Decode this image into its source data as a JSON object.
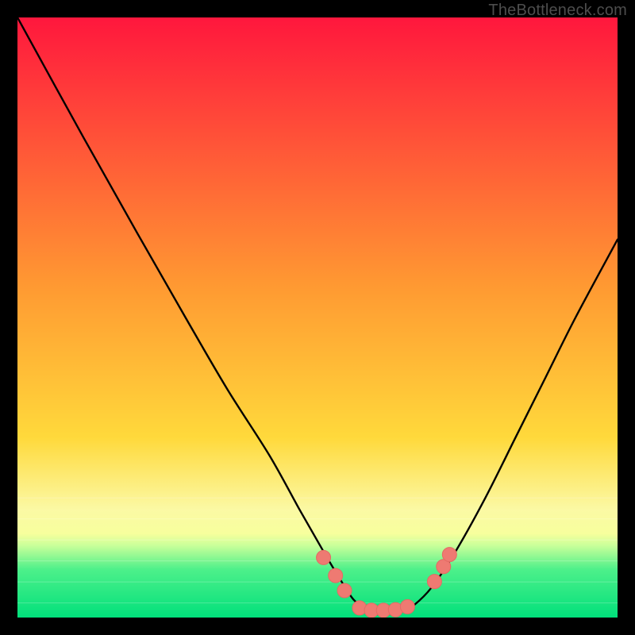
{
  "attribution": "TheBottleneck.com",
  "colors": {
    "grad_top": "#ff173d",
    "grad_mid": "#ffd93b",
    "grad_band_light": "#fbf9a4",
    "grad_band_green_top": "#4df08a",
    "grad_band_green_bot": "#01e07b",
    "curve": "#000000",
    "marker_fill": "#ee7a72",
    "marker_stroke": "#e46a63"
  },
  "chart_data": {
    "type": "line",
    "title": "",
    "xlabel": "",
    "ylabel": "",
    "xlim": [
      0,
      100
    ],
    "ylim": [
      0,
      100
    ],
    "series": [
      {
        "name": "bottleneck-curve",
        "x": [
          0,
          11,
          20,
          28,
          35,
          42,
          47,
          51,
          54,
          56,
          58,
          60,
          62,
          64,
          66,
          69,
          73,
          78,
          83,
          88,
          93,
          100
        ],
        "y": [
          100,
          80,
          64,
          50,
          38,
          27,
          18,
          11,
          6,
          3,
          1.5,
          1,
          1,
          1,
          2,
          5,
          11,
          20,
          30,
          40,
          50,
          63
        ]
      }
    ],
    "markers": [
      {
        "x": 51.0,
        "y": 10.0
      },
      {
        "x": 53.0,
        "y": 7.0
      },
      {
        "x": 54.5,
        "y": 4.5
      },
      {
        "x": 57.0,
        "y": 1.6
      },
      {
        "x": 59.0,
        "y": 1.2
      },
      {
        "x": 61.0,
        "y": 1.2
      },
      {
        "x": 63.0,
        "y": 1.3
      },
      {
        "x": 65.0,
        "y": 1.8
      },
      {
        "x": 69.5,
        "y": 6.0
      },
      {
        "x": 71.0,
        "y": 8.5
      },
      {
        "x": 72.0,
        "y": 10.5
      }
    ]
  }
}
